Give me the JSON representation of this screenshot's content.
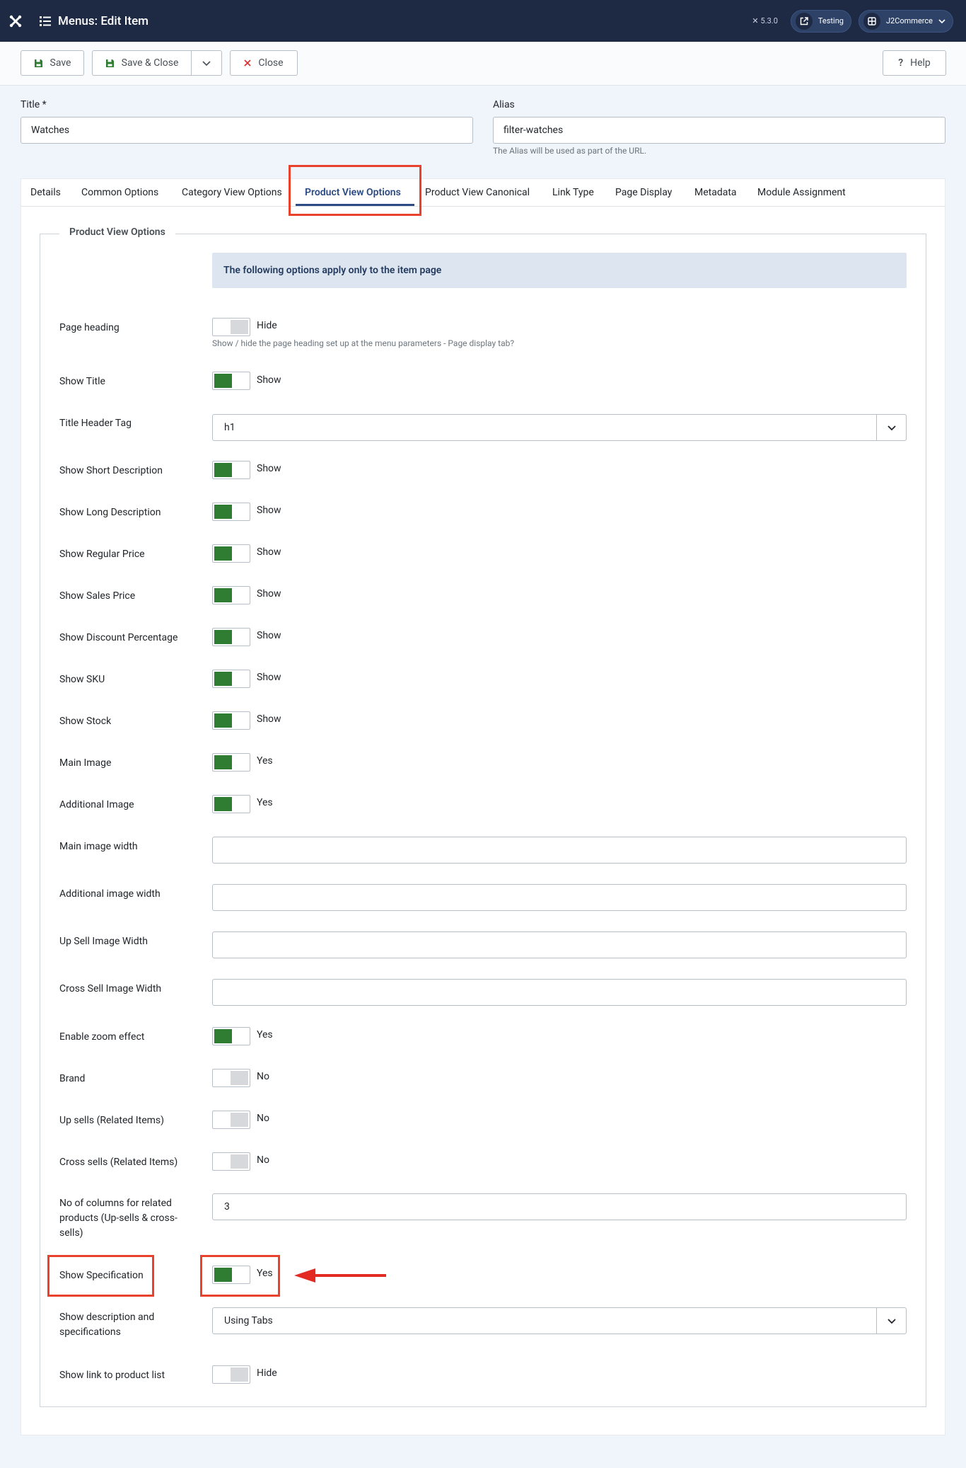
{
  "header": {
    "title": "Menus: Edit Item",
    "version": "5.3.0",
    "site_pill": "Testing",
    "user_pill": "J2Commerce"
  },
  "toolbar": {
    "save": "Save",
    "save_close": "Save & Close",
    "close": "Close",
    "help": "Help"
  },
  "form": {
    "title_label": "Title *",
    "title_value": "Watches",
    "alias_label": "Alias",
    "alias_value": "filter-watches",
    "alias_hint": "The Alias will be used as part of the URL."
  },
  "tabs": [
    "Details",
    "Common Options",
    "Category View Options",
    "Product View Options",
    "Product View Canonical",
    "Link Type",
    "Page Display",
    "Metadata",
    "Module Assignment"
  ],
  "active_tab": "Product View Options",
  "panel": {
    "legend": "Product View Options",
    "alert": "The following options apply only to the item page",
    "page_heading": {
      "label": "Page heading",
      "state": "Hide",
      "on": false,
      "hint": "Show / hide the page heading set up at the menu parameters - Page display tab?"
    },
    "show_title": {
      "label": "Show Title",
      "state": "Show",
      "on": true
    },
    "title_header_tag": {
      "label": "Title Header Tag",
      "value": "h1"
    },
    "short_description": {
      "label": "Show Short Description",
      "state": "Show",
      "on": true
    },
    "long_description": {
      "label": "Show Long Description",
      "state": "Show",
      "on": true
    },
    "regular_price": {
      "label": "Show Regular Price",
      "state": "Show",
      "on": true
    },
    "sales_price": {
      "label": "Show Sales Price",
      "state": "Show",
      "on": true
    },
    "discount_percentage": {
      "label": "Show Discount Percentage",
      "state": "Show",
      "on": true
    },
    "sku": {
      "label": "Show SKU",
      "state": "Show",
      "on": true
    },
    "stock": {
      "label": "Show Stock",
      "state": "Show",
      "on": true
    },
    "main_image": {
      "label": "Main Image",
      "state": "Yes",
      "on": true
    },
    "additional_image": {
      "label": "Additional Image",
      "state": "Yes",
      "on": true
    },
    "main_image_width": {
      "label": "Main image width",
      "value": ""
    },
    "additional_image_width": {
      "label": "Additional image width",
      "value": ""
    },
    "upsell_image_width": {
      "label": "Up Sell Image Width",
      "value": ""
    },
    "crosssell_image_width": {
      "label": "Cross Sell Image Width",
      "value": ""
    },
    "zoom_effect": {
      "label": "Enable zoom effect",
      "state": "Yes",
      "on": true
    },
    "brand": {
      "label": "Brand",
      "state": "No",
      "on": false
    },
    "upsells": {
      "label": "Up sells (Related Items)",
      "state": "No",
      "on": false
    },
    "crosssells": {
      "label": "Cross sells (Related Items)",
      "state": "No",
      "on": false
    },
    "related_columns": {
      "label_line1": "No of columns for related",
      "label_line2": "products (Up-sells & cross-",
      "label_line3": "sells)",
      "value": "3"
    },
    "show_specification": {
      "label": "Show Specification",
      "state": "Yes",
      "on": true
    },
    "desc_and_specs": {
      "label_line1": "Show description and",
      "label_line2": "specifications",
      "value": "Using Tabs"
    },
    "product_list_link": {
      "label": "Show link to product list",
      "state": "Hide",
      "on": false
    }
  },
  "colors": {
    "header_bg": "#1e2a44",
    "toggle_on": "#2e7d32",
    "highlight": "#e8412c",
    "active_tab": "#2c4a83"
  }
}
